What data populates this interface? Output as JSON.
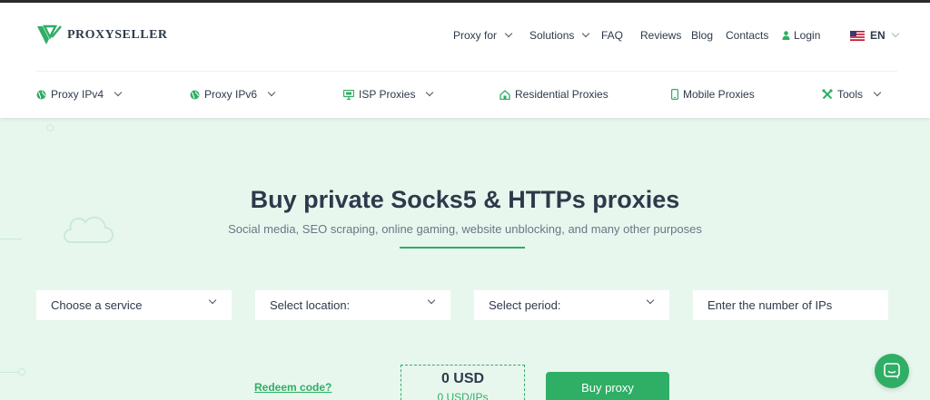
{
  "brand": {
    "name": "PROXYSELLER"
  },
  "topnav": {
    "proxy_for": "Proxy for",
    "solutions": "Solutions",
    "faq": "FAQ",
    "reviews": "Reviews",
    "blog": "Blog",
    "contacts": "Contacts",
    "login": "Login",
    "language": "EN"
  },
  "subnav": {
    "items": [
      {
        "label": "Proxy IPv4",
        "icon": "globe-icon"
      },
      {
        "label": "Proxy IPv6",
        "icon": "globe-icon"
      },
      {
        "label": "ISP Proxies",
        "icon": "server-icon"
      },
      {
        "label": "Residential Proxies",
        "icon": "home-icon"
      },
      {
        "label": "Mobile Proxies",
        "icon": "phone-icon"
      },
      {
        "label": "Tools",
        "icon": "tools-icon"
      }
    ]
  },
  "hero": {
    "title": "Buy private Socks5 & HTTPs proxies",
    "subtitle": "Social media, SEO scraping, online gaming, website unblocking, and many other purposes"
  },
  "form": {
    "service": "Choose a service",
    "location": "Select location:",
    "period": "Select period:",
    "ips_placeholder": "Enter the number of IPs"
  },
  "order": {
    "redeem": "Redeem code?",
    "total": "0 USD",
    "per_ip": "0 USD/IPs",
    "buy": "Buy proxy"
  },
  "colors": {
    "accent": "#2fae65",
    "background": "#e8f7ee",
    "text": "#2d3a4a"
  }
}
